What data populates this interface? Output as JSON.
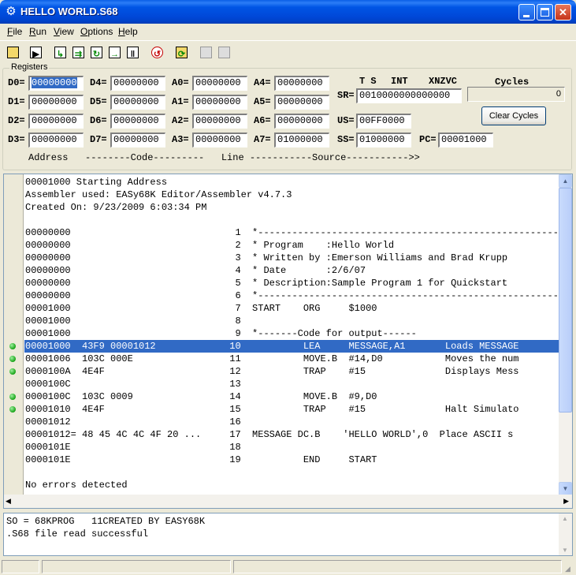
{
  "window": {
    "title": "HELLO WORLD.S68",
    "icon": "gear-icon",
    "accent": "#0055e5"
  },
  "menu": [
    {
      "label": "File",
      "key": "F"
    },
    {
      "label": "Run",
      "key": "R"
    },
    {
      "label": "View",
      "key": "V"
    },
    {
      "label": "Options",
      "key": "O"
    },
    {
      "label": "Help",
      "key": "H"
    }
  ],
  "toolbar": [
    {
      "icon": "open-folder-icon",
      "enabled": true
    },
    {
      "icon": "run-icon",
      "enabled": true
    },
    {
      "icon": "step-into-icon",
      "enabled": true
    },
    {
      "icon": "step-over-icon",
      "enabled": true
    },
    {
      "icon": "trace-icon",
      "enabled": true
    },
    {
      "icon": "run-to-cursor-icon",
      "enabled": true
    },
    {
      "icon": "pause-icon",
      "enabled": true
    },
    {
      "icon": "reset-icon",
      "enabled": true
    },
    {
      "icon": "reload-icon",
      "enabled": true
    },
    {
      "icon": "log-icon",
      "enabled": false
    },
    {
      "icon": "stop-log-icon",
      "enabled": false
    }
  ],
  "registers": {
    "legend": "Registers",
    "D0": "00000000",
    "D1": "00000000",
    "D2": "00000000",
    "D3": "00000000",
    "D4": "00000000",
    "D5": "00000000",
    "D6": "00000000",
    "D7": "00000000",
    "A0": "00000000",
    "A1": "00000000",
    "A2": "00000000",
    "A3": "00000000",
    "A4": "00000000",
    "A5": "00000000",
    "A6": "00000000",
    "A7": "01000000",
    "SR": "0010000000000000",
    "US": "00FF0000",
    "SS": "01000000",
    "PC": "00001000",
    "flags_header_1": "T S",
    "flags_header_2": "INT",
    "flags_header_3": "XNZVC",
    "cycles_label": "Cycles",
    "cycles_value": "0",
    "clear_cycles": "Clear Cycles"
  },
  "column_header": "Address   --------Code---------   Line -----------Source----------->>",
  "listing": {
    "selected_index": 13,
    "breakpoint_rows": [
      13,
      14,
      15,
      17,
      18
    ],
    "lines": [
      "00001000 Starting Address",
      "Assembler used: EASy68K Editor/Assembler v4.7.3",
      "Created On: 9/23/2009 6:03:34 PM",
      "",
      "00000000                             1  *-----------------------------------------------------------",
      "00000000                             2  * Program    :Hello World",
      "00000000                             3  * Written by :Emerson Williams and Brad Krupp",
      "00000000                             4  * Date       :2/6/07",
      "00000000                             5  * Description:Sample Program 1 for Quickstart",
      "00000000                             6  *-----------------------------------------------------------",
      "00001000                             7  START    ORG     $1000",
      "00001000                             8",
      "00001000                             9  *-------Code for output------",
      "00001000  43F9 00001012             10           LEA     MESSAGE,A1       Loads MESSAGE",
      "00001006  103C 000E                 11           MOVE.B  #14,D0           Moves the num",
      "0000100A  4E4F                      12           TRAP    #15              Displays Mess",
      "0000100C                            13",
      "0000100C  103C 0009                 14           MOVE.B  #9,D0",
      "00001010  4E4F                      15           TRAP    #15              Halt Simulato",
      "00001012                            16",
      "00001012= 48 45 4C 4C 4F 20 ...     17  MESSAGE DC.B    'HELLO WORLD',0  Place ASCII s",
      "0000101E                            18",
      "0000101E                            19           END     START",
      "",
      "No errors detected"
    ]
  },
  "messages": [
    "SO = 68KPROG   11CREATED BY EASY68K",
    ".S68 file read successful"
  ],
  "colors": {
    "selection": "#316ac5",
    "breakpoint": "#16a316"
  }
}
